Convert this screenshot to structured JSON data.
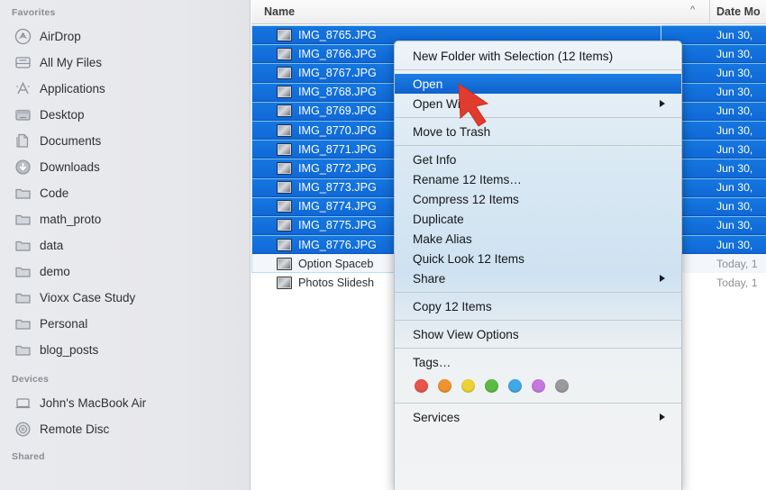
{
  "sidebar": {
    "groups": [
      {
        "label": "Favorites",
        "items": [
          {
            "label": "AirDrop",
            "icon": "airdrop-icon"
          },
          {
            "label": "All My Files",
            "icon": "all-my-files-icon"
          },
          {
            "label": "Applications",
            "icon": "applications-icon"
          },
          {
            "label": "Desktop",
            "icon": "desktop-icon"
          },
          {
            "label": "Documents",
            "icon": "documents-icon"
          },
          {
            "label": "Downloads",
            "icon": "downloads-icon"
          },
          {
            "label": "Code",
            "icon": "folder-icon"
          },
          {
            "label": "math_proto",
            "icon": "folder-icon"
          },
          {
            "label": "data",
            "icon": "folder-icon"
          },
          {
            "label": "demo",
            "icon": "folder-icon"
          },
          {
            "label": "Vioxx Case Study",
            "icon": "folder-icon"
          },
          {
            "label": "Personal",
            "icon": "folder-icon"
          },
          {
            "label": "blog_posts",
            "icon": "folder-icon"
          }
        ]
      },
      {
        "label": "Devices",
        "items": [
          {
            "label": "John's MacBook Air",
            "icon": "laptop-icon"
          },
          {
            "label": "Remote Disc",
            "icon": "disc-icon"
          }
        ]
      },
      {
        "label": "Shared",
        "items": []
      }
    ]
  },
  "columns": {
    "name": "Name",
    "sort_indicator": "chevron-up-icon",
    "date_modified": "Date Mo"
  },
  "files": [
    {
      "name": "IMG_8765.JPG",
      "date": "Jun 30,",
      "selected": true
    },
    {
      "name": "IMG_8766.JPG",
      "date": "Jun 30,",
      "selected": true
    },
    {
      "name": "IMG_8767.JPG",
      "date": "Jun 30,",
      "selected": true
    },
    {
      "name": "IMG_8768.JPG",
      "date": "Jun 30,",
      "selected": true
    },
    {
      "name": "IMG_8769.JPG",
      "date": "Jun 30,",
      "selected": true
    },
    {
      "name": "IMG_8770.JPG",
      "date": "Jun 30,",
      "selected": true
    },
    {
      "name": "IMG_8771.JPG",
      "date": "Jun 30,",
      "selected": true
    },
    {
      "name": "IMG_8772.JPG",
      "date": "Jun 30,",
      "selected": true
    },
    {
      "name": "IMG_8773.JPG",
      "date": "Jun 30,",
      "selected": true
    },
    {
      "name": "IMG_8774.JPG",
      "date": "Jun 30,",
      "selected": true
    },
    {
      "name": "IMG_8775.JPG",
      "date": "Jun 30,",
      "selected": true
    },
    {
      "name": "IMG_8776.JPG",
      "date": "Jun 30,",
      "selected": true
    },
    {
      "name": "Option Spaceb",
      "date": "Today, 1",
      "selected": false
    },
    {
      "name": "Photos Slidesh",
      "date": "Today, 1",
      "selected": false
    }
  ],
  "context_menu": {
    "items": [
      {
        "label": "New Folder with Selection (12 Items)",
        "kind": "item",
        "submenu": false,
        "highlighted": false
      },
      {
        "kind": "separator"
      },
      {
        "label": "Open",
        "kind": "item",
        "submenu": false,
        "highlighted": true
      },
      {
        "label": "Open With",
        "kind": "item",
        "submenu": true,
        "highlighted": false
      },
      {
        "kind": "separator"
      },
      {
        "label": "Move to Trash",
        "kind": "item",
        "submenu": false,
        "highlighted": false
      },
      {
        "kind": "separator"
      },
      {
        "label": "Get Info",
        "kind": "item",
        "submenu": false,
        "highlighted": false
      },
      {
        "label": "Rename 12 Items…",
        "kind": "item",
        "submenu": false,
        "highlighted": false
      },
      {
        "label": "Compress 12 Items",
        "kind": "item",
        "submenu": false,
        "highlighted": false
      },
      {
        "label": "Duplicate",
        "kind": "item",
        "submenu": false,
        "highlighted": false
      },
      {
        "label": "Make Alias",
        "kind": "item",
        "submenu": false,
        "highlighted": false
      },
      {
        "label": "Quick Look 12 Items",
        "kind": "item",
        "submenu": false,
        "highlighted": false
      },
      {
        "label": "Share",
        "kind": "item",
        "submenu": true,
        "highlighted": false
      },
      {
        "kind": "separator"
      },
      {
        "label": "Copy 12 Items",
        "kind": "item",
        "submenu": false,
        "highlighted": false
      },
      {
        "kind": "separator"
      },
      {
        "label": "Show View Options",
        "kind": "item",
        "submenu": false,
        "highlighted": false
      },
      {
        "kind": "separator"
      },
      {
        "label": "Tags…",
        "kind": "item",
        "submenu": false,
        "highlighted": false
      },
      {
        "kind": "tags"
      },
      {
        "kind": "separator"
      },
      {
        "label": "Services",
        "kind": "item",
        "submenu": true,
        "highlighted": false
      }
    ],
    "tag_colors": [
      "#e8554a",
      "#f0922f",
      "#ebd334",
      "#5cba46",
      "#3fa9e8",
      "#c579e0",
      "#9a9a9a"
    ],
    "tag_names": [
      "red-tag",
      "orange-tag",
      "yellow-tag",
      "green-tag",
      "blue-tag",
      "purple-tag",
      "gray-tag"
    ]
  },
  "cursor": {
    "name": "red-arrow-pointer",
    "color": "#e03b2f"
  },
  "colors": {
    "selection_blue": "#1068d6",
    "sidebar_bg": "#e9eaee",
    "menu_highlight": "#0f62cf"
  }
}
